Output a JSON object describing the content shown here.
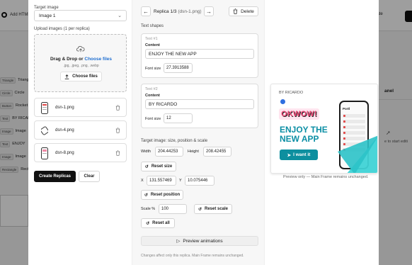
{
  "background": {
    "add_html_label": "Add HTML",
    "action_label": "icate",
    "layers": [
      {
        "tag": "Triangle",
        "name": "Triangl"
      },
      {
        "tag": "Circle",
        "name": "Circle"
      },
      {
        "tag": "Button",
        "name": "Rocket"
      },
      {
        "tag": "Text",
        "name": "BY RICARD"
      },
      {
        "tag": "Image",
        "name": "Image"
      },
      {
        "tag": "Text",
        "name": "ENJOY"
      },
      {
        "tag": "Image",
        "name": "Image"
      },
      {
        "tag": "Rectangle",
        "name": "Recta"
      }
    ],
    "right_panel_label": "anel",
    "right_panel_hint": "e to start editi"
  },
  "left": {
    "target_label": "Target image",
    "target_value": "Image 1",
    "upload_label": "Upload images (1 per replica)",
    "dropzone_text": "Drag & Drop or",
    "dropzone_link": "Choose files",
    "dropzone_types": ".jpg, .jpeg, .png, .webp",
    "choose_button": "Choose files",
    "files": [
      "dsn-1.png",
      "dsn-4.png",
      "dsn-8.png"
    ],
    "create_button": "Create Replicas",
    "clear_button": "Clear"
  },
  "middle": {
    "replica_title": "Replica 1/3",
    "replica_file": "(dsn-1.png)",
    "delete_label": "Delete",
    "text_shapes_label": "Text shapes",
    "text_shapes": [
      {
        "header": "Text #1",
        "content_label": "Content",
        "content": "ENJOY THE NEW APP",
        "font_size_label": "Font size",
        "font_size": "27.3913588"
      },
      {
        "header": "Text #2",
        "content_label": "Content",
        "content": "BY RICARDO",
        "font_size_label": "Font size",
        "font_size": "12"
      }
    ],
    "target_image_label": "Target image: size, position & scale",
    "width_label": "Width",
    "width_value": "204.44253",
    "height_label": "Height",
    "height_value": "208.42455",
    "reset_size": "Reset size",
    "x_label": "X",
    "x_value": "131.557469",
    "y_label": "Y",
    "y_value": "10.075446",
    "reset_position": "Reset position",
    "scale_label": "Scale %",
    "scale_value": "100",
    "reset_scale": "Reset scale",
    "reset_all": "Reset all",
    "preview_animations": "Preview animations",
    "note": "Changes affect only this replica. Main Frame remains unchanged."
  },
  "preview": {
    "brand": "BY RICARDO",
    "wow_text": "OKWOW!",
    "headline": "ENJOY THE NEW APP",
    "cta": "I want it",
    "phone_brand": "Portl",
    "caption": "Preview only — Main Frame remains unchanged.",
    "colors": {
      "teal": "#0d8f9f",
      "headline": "#0c8fa5",
      "pink": "#f24a7a",
      "blue_dot": "#2f6fe0",
      "triangle": "#3fd3d6"
    }
  }
}
